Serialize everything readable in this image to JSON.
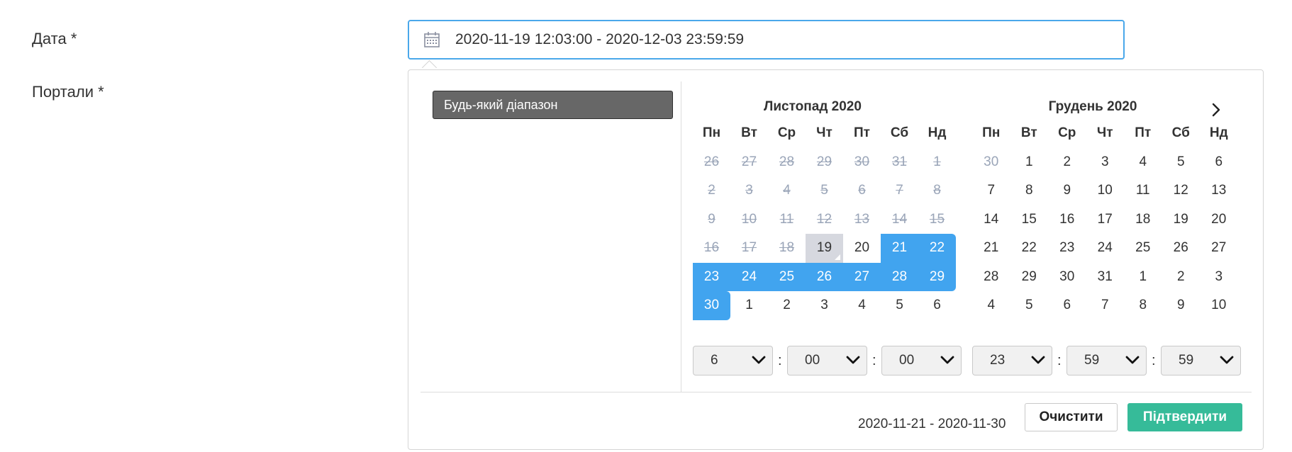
{
  "form": {
    "date_label": "Дата *",
    "portals_label": "Портали *",
    "date_value": "2020-11-19 12:03:00 - 2020-12-03 23:59:59"
  },
  "picker": {
    "range_option": "Будь-який діапазон",
    "left_month": "Листопад 2020",
    "right_month": "Грудень 2020",
    "weekdays": [
      "Пн",
      "Вт",
      "Ср",
      "Чт",
      "Пт",
      "Сб",
      "Нд"
    ],
    "left_days": [
      [
        "26",
        "27",
        "28",
        "29",
        "30",
        "31",
        "1"
      ],
      [
        "2",
        "3",
        "4",
        "5",
        "6",
        "7",
        "8"
      ],
      [
        "9",
        "10",
        "11",
        "12",
        "13",
        "14",
        "15"
      ],
      [
        "16",
        "17",
        "18",
        "19",
        "20",
        "21",
        "22"
      ],
      [
        "23",
        "24",
        "25",
        "26",
        "27",
        "28",
        "29"
      ],
      [
        "30",
        "1",
        "2",
        "3",
        "4",
        "5",
        "6"
      ]
    ],
    "right_days": [
      [
        "30",
        "1",
        "2",
        "3",
        "4",
        "5",
        "6"
      ],
      [
        "7",
        "8",
        "9",
        "10",
        "11",
        "12",
        "13"
      ],
      [
        "14",
        "15",
        "16",
        "17",
        "18",
        "19",
        "20"
      ],
      [
        "21",
        "22",
        "23",
        "24",
        "25",
        "26",
        "27"
      ],
      [
        "28",
        "29",
        "30",
        "31",
        "1",
        "2",
        "3"
      ],
      [
        "4",
        "5",
        "6",
        "7",
        "8",
        "9",
        "10"
      ]
    ],
    "start_time": {
      "hour": "6",
      "minute": "00",
      "second": "00"
    },
    "end_time": {
      "hour": "23",
      "minute": "59",
      "second": "59"
    },
    "selected_range": "2020-11-21 - 2020-11-30",
    "clear_label": "Очистити",
    "confirm_label": "Підтвердити"
  },
  "colors": {
    "accent": "#41a4ef",
    "confirm": "#36bb99",
    "range_button": "#676767",
    "disabled_text": "#9aa5b8"
  }
}
